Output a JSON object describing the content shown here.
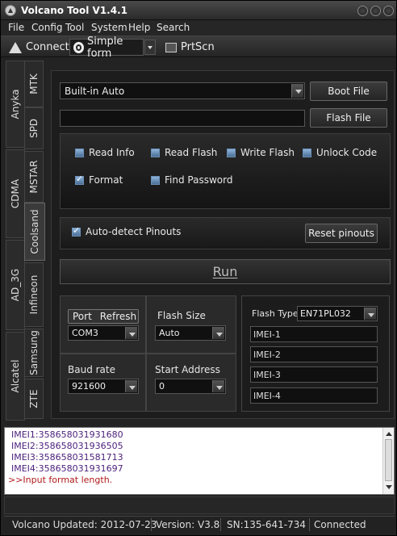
{
  "window": {
    "title": "Volcano Tool V1.4.1"
  },
  "menu": [
    "File",
    "Config",
    "Tool",
    "System",
    "Help",
    "Search"
  ],
  "toolbar": {
    "connect": "Connect",
    "mode": "Simple form",
    "prtscn": "PrtScn"
  },
  "groups": [
    "Anyka",
    "CDMA",
    "AD_3G",
    "Alcatel"
  ],
  "tabs": [
    "MTK",
    "SPD",
    "MSTAR",
    "Coolsand",
    "Infineon",
    "Samsung",
    "ZTE"
  ],
  "active_tab": "Coolsand",
  "main": {
    "mode_combo": "Built-in Auto",
    "flash_path": "",
    "boot_file": "Boot File",
    "flash_file": "Flash File",
    "options": [
      {
        "label": "Read Info",
        "checked": false
      },
      {
        "label": "Read Flash",
        "checked": false
      },
      {
        "label": "Write Flash",
        "checked": false
      },
      {
        "label": "Unlock Code",
        "checked": false
      },
      {
        "label": "Format",
        "checked": true
      },
      {
        "label": "Find Password",
        "checked": false
      }
    ],
    "auto_detect": {
      "label": "Auto-detect Pinouts",
      "checked": true
    },
    "reset_pinouts": "Reset pinouts",
    "run": "Run",
    "port_label": "Port",
    "refresh_label": "Refresh",
    "port_value": "COM3",
    "flash_size_label": "Flash Size",
    "flash_size_value": "Auto",
    "baud_label": "Baud rate",
    "baud_value": "921600",
    "start_addr_label": "Start Address",
    "start_addr_value": "0",
    "flash_type_label": "Flash Type",
    "flash_type_value": "EN71PL032",
    "imei": [
      "IMEI-1",
      "IMEI-2",
      "IMEI-3",
      "IMEI-4"
    ]
  },
  "log": [
    {
      "text": "IMEI1:358658031931680",
      "type": "info"
    },
    {
      "text": "IMEI2:358658031936505",
      "type": "info"
    },
    {
      "text": "IMEI3:358658031581713",
      "type": "info"
    },
    {
      "text": "IMEI4:358658031931697",
      "type": "info"
    },
    {
      "text": ">>Input format length.",
      "type": "error"
    }
  ],
  "status": {
    "updated": "Volcano Updated: 2012-07-23",
    "version": "Version: V3.8",
    "sn": "SN:135-641-734",
    "connection": "Connected"
  }
}
